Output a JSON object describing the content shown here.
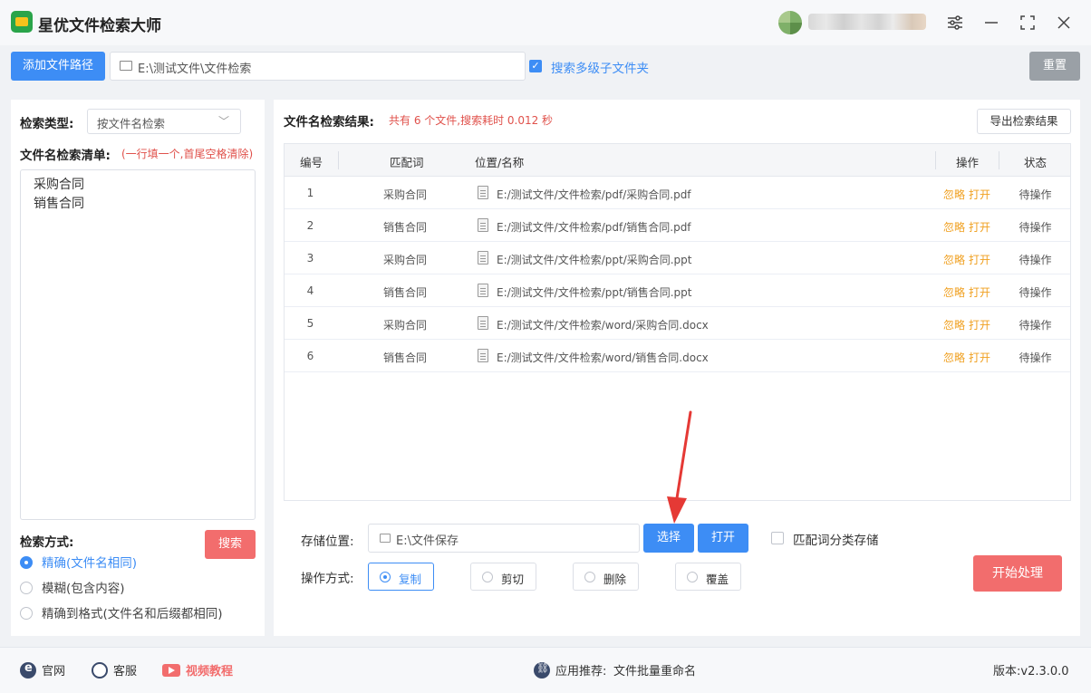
{
  "app": {
    "title": "星优文件检索大师"
  },
  "window": {
    "controls": [
      "settings",
      "minimize",
      "maximize",
      "close"
    ]
  },
  "toolbar": {
    "add_path_label": "添加文件路径",
    "path_value": "E:\\测试文件\\文件检索",
    "include_subfolders": true,
    "include_subfolders_label": "搜索多级子文件夹",
    "reset_label": "重置"
  },
  "left": {
    "search_type_label": "检索类型:",
    "search_type_value": "按文件名检索",
    "list_label": "文件名检索清单:",
    "list_hint": "(一行填一个,首尾空格清除)",
    "keywords": [
      "采购合同",
      "销售合同"
    ],
    "search_mode_label": "检索方式:",
    "search_button": "搜索",
    "modes": [
      {
        "label": "精确(文件名相同)",
        "selected": true
      },
      {
        "label": "模糊(包含内容)",
        "selected": false
      },
      {
        "label": "精确到格式(文件名和后缀都相同)",
        "selected": false
      }
    ]
  },
  "results": {
    "title": "文件名检索结果:",
    "summary": "共有 6 个文件,搜索耗时 0.012 秒",
    "export_label": "导出检索结果",
    "columns": {
      "no": "编号",
      "keyword": "匹配词",
      "path": "位置/名称",
      "ops": "操作",
      "status": "状态"
    },
    "rows": [
      {
        "no": "1",
        "keyword": "采购合同",
        "path": "E:/测试文件/文件检索/pdf/采购合同.pdf",
        "ignore": "忽略",
        "open": "打开",
        "status": "待操作"
      },
      {
        "no": "2",
        "keyword": "销售合同",
        "path": "E:/测试文件/文件检索/pdf/销售合同.pdf",
        "ignore": "忽略",
        "open": "打开",
        "status": "待操作"
      },
      {
        "no": "3",
        "keyword": "采购合同",
        "path": "E:/测试文件/文件检索/ppt/采购合同.ppt",
        "ignore": "忽略",
        "open": "打开",
        "status": "待操作"
      },
      {
        "no": "4",
        "keyword": "销售合同",
        "path": "E:/测试文件/文件检索/ppt/销售合同.ppt",
        "ignore": "忽略",
        "open": "打开",
        "status": "待操作"
      },
      {
        "no": "5",
        "keyword": "采购合同",
        "path": "E:/测试文件/文件检索/word/采购合同.docx",
        "ignore": "忽略",
        "open": "打开",
        "status": "待操作"
      },
      {
        "no": "6",
        "keyword": "销售合同",
        "path": "E:/测试文件/文件检索/word/销售合同.docx",
        "ignore": "忽略",
        "open": "打开",
        "status": "待操作"
      }
    ]
  },
  "output": {
    "store_label": "存储位置:",
    "store_value": "E:\\文件保存",
    "choose_label": "选择",
    "open_label": "打开",
    "classify_label": "匹配词分类存储",
    "classify_checked": false,
    "op_label": "操作方式:",
    "op_options": [
      {
        "label": "复制",
        "selected": true
      },
      {
        "label": "剪切",
        "selected": false
      },
      {
        "label": "删除",
        "selected": false
      },
      {
        "label": "覆盖",
        "selected": false
      }
    ],
    "start_label": "开始处理"
  },
  "footer": {
    "site": "官网",
    "service": "客服",
    "video": "视频教程",
    "recommend_label": "应用推荐:",
    "recommend_app": "文件批量重命名",
    "version": "版本:v2.3.0.0"
  },
  "colors": {
    "primary": "#3d8df5",
    "danger": "#f26d6d",
    "warning": "#f0a020",
    "annotation": "#e53935"
  }
}
